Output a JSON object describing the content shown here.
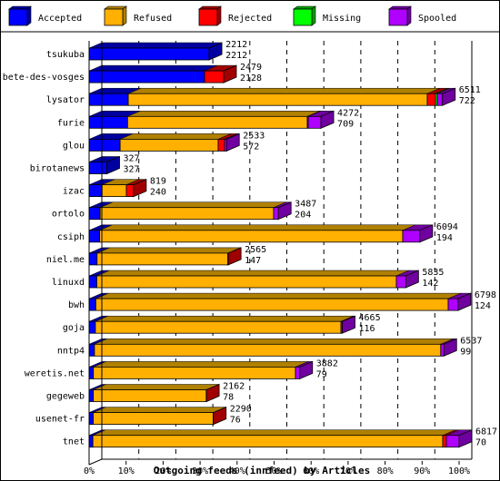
{
  "chart_data": {
    "type": "bar",
    "orientation": "horizontal",
    "stacked": true,
    "style": "3d",
    "title": "",
    "xlabel": "Outgoing feeds (innfeed) by Articles",
    "ylabel": "",
    "xlim": [
      0,
      100
    ],
    "x_unit": "%",
    "x_ticks": [
      "0%",
      "10%",
      "20%",
      "30%",
      "40%",
      "50%",
      "60%",
      "70%",
      "80%",
      "90%",
      "100%"
    ],
    "grid": "vertical dashed",
    "legend_position": "top",
    "scale_max": 6817,
    "series": [
      {
        "name": "Accepted",
        "color": "#0000ff",
        "side_color": "#0000a0"
      },
      {
        "name": "Refused",
        "color": "#ffb000",
        "side_color": "#b08000"
      },
      {
        "name": "Rejected",
        "color": "#ff0000",
        "side_color": "#a00000"
      },
      {
        "name": "Missing",
        "color": "#00ff00",
        "side_color": "#00a000"
      },
      {
        "name": "Spooled",
        "color": "#b000ff",
        "side_color": "#7000a0"
      }
    ],
    "categories": [
      "tsukuba",
      "bete-des-vosges",
      "lysator",
      "furie",
      "glou",
      "birotanews",
      "izac",
      "ortolo",
      "csiph",
      "niel.me",
      "linuxd",
      "bwh",
      "goja",
      "nntp4",
      "weretis.net",
      "gegeweb",
      "usenet-fr",
      "tnet"
    ],
    "rows": [
      {
        "name": "tsukuba",
        "total": 2212,
        "accepted_label": 2212,
        "values": [
          2212,
          0,
          0,
          0,
          0
        ]
      },
      {
        "name": "bete-des-vosges",
        "total": 2479,
        "accepted_label": 2128,
        "values": [
          2128,
          0,
          351,
          0,
          0
        ]
      },
      {
        "name": "lysator",
        "total": 6511,
        "accepted_label": 722,
        "values": [
          722,
          5509,
          150,
          33,
          97
        ]
      },
      {
        "name": "furie",
        "total": 4272,
        "accepted_label": 709,
        "values": [
          709,
          3311,
          0,
          17,
          235
        ]
      },
      {
        "name": "glou",
        "total": 2533,
        "accepted_label": 572,
        "values": [
          572,
          1806,
          117,
          0,
          38
        ]
      },
      {
        "name": "birotanews",
        "total": 327,
        "accepted_label": 327,
        "values": [
          327,
          0,
          0,
          0,
          0
        ]
      },
      {
        "name": "izac",
        "total": 819,
        "accepted_label": 240,
        "values": [
          240,
          447,
          132,
          0,
          0
        ]
      },
      {
        "name": "ortolo",
        "total": 3487,
        "accepted_label": 204,
        "values": [
          204,
          3196,
          0,
          0,
          87
        ]
      },
      {
        "name": "csiph",
        "total": 6094,
        "accepted_label": 194,
        "values": [
          194,
          5584,
          0,
          0,
          316
        ]
      },
      {
        "name": "niel.me",
        "total": 2565,
        "accepted_label": 147,
        "values": [
          147,
          2410,
          8,
          0,
          0
        ]
      },
      {
        "name": "linuxd",
        "total": 5835,
        "accepted_label": 142,
        "values": [
          142,
          5519,
          0,
          0,
          174
        ]
      },
      {
        "name": "bwh",
        "total": 6798,
        "accepted_label": 124,
        "values": [
          124,
          6492,
          0,
          0,
          182
        ]
      },
      {
        "name": "goja",
        "total": 4665,
        "accepted_label": 116,
        "values": [
          116,
          4524,
          0,
          0,
          25
        ]
      },
      {
        "name": "nntp4",
        "total": 6537,
        "accepted_label": 99,
        "values": [
          99,
          6380,
          0,
          0,
          58
        ]
      },
      {
        "name": "weretis.net",
        "total": 3882,
        "accepted_label": 79,
        "values": [
          79,
          3723,
          0,
          0,
          80
        ]
      },
      {
        "name": "gegeweb",
        "total": 2162,
        "accepted_label": 78,
        "values": [
          78,
          2080,
          4,
          0,
          0
        ]
      },
      {
        "name": "usenet-fr",
        "total": 2290,
        "accepted_label": 76,
        "values": [
          76,
          2210,
          4,
          0,
          0
        ]
      },
      {
        "name": "tnet",
        "total": 6817,
        "accepted_label": 70,
        "values": [
          70,
          6445,
          67,
          0,
          235
        ]
      }
    ]
  }
}
